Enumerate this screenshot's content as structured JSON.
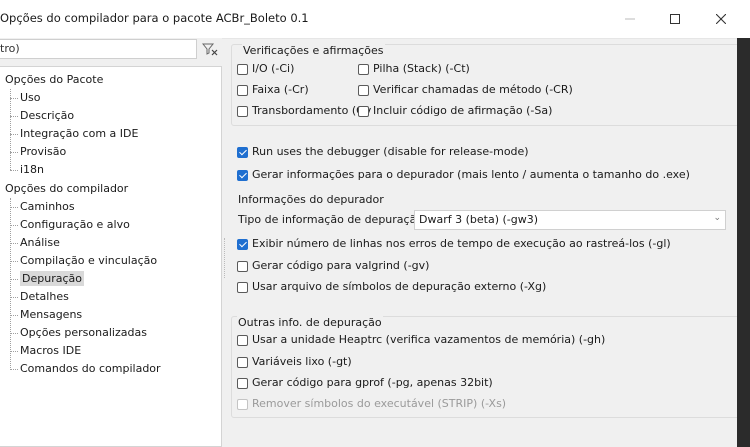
{
  "window": {
    "title": "Opções do compilador para o pacote ACBr_Boleto 0.1"
  },
  "filter": {
    "value": "tro)"
  },
  "tree": {
    "package_root": "Opções do Pacote",
    "package_children": [
      "Uso",
      "Descrição",
      "Integração com a IDE",
      "Provisão",
      "i18n"
    ],
    "compiler_root": "Opções do compilador",
    "compiler_children": [
      "Caminhos",
      "Configuração e alvo",
      "Análise",
      "Compilação e vinculação",
      "Depuração",
      "Detalhes",
      "Mensagens",
      "Opções personalizadas",
      "Macros IDE",
      "Comandos do compilador"
    ],
    "selected": "Depuração"
  },
  "checks_group": {
    "legend": "Verificações e afirmações",
    "io": "I/O (-Ci)",
    "stack": "Pilha (Stack) (-Ct)",
    "range": "Faixa (-Cr)",
    "method": "Verificar chamadas de método (-CR)",
    "overflow": "Transbordamento (Ov",
    "assert": "Incluir código de afirmação (-Sa)"
  },
  "run_debugger": "Run uses the debugger (disable for release-mode)",
  "gen_debug_info": "Gerar informações para o depurador (mais lento / aumenta o tamanho do .exe)",
  "debug_info_group": {
    "legend": "Informações do depurador",
    "type_label": "Tipo de informação de depuração",
    "type_value": "Dwarf 3 (beta) (-gw3)",
    "line_numbers": "Exibir número de linhas nos erros de tempo de execução ao rastreá-los (-gl)",
    "valgrind": "Gerar código para valgrind (-gv)",
    "external_symbols": "Usar arquivo de símbolos de depuração externo (-Xg)"
  },
  "other_group": {
    "legend": "Outras info. de depuração",
    "heaptrc": "Usar a unidade Heaptrc (verifica vazamentos de memória) (-gh)",
    "trash_vars": "Variáveis lixo (-gt)",
    "gprof": "Gerar código para gprof (-pg, apenas 32bit)",
    "strip": "Remover símbolos do executável (STRIP) (-Xs)"
  },
  "colors": {
    "accent": "#1f6fd0",
    "selected_row": "#d9d9d9"
  }
}
